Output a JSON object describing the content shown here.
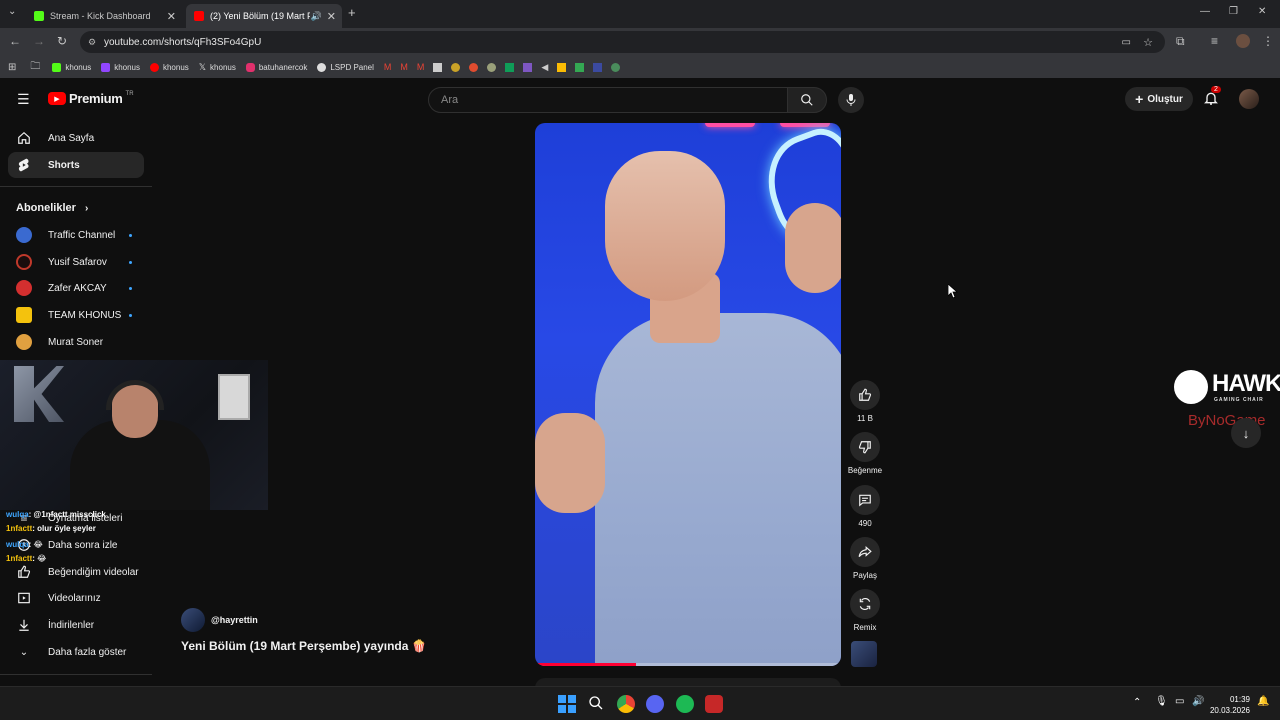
{
  "browser": {
    "tabs": [
      {
        "title": "Stream - Kick Dashboard",
        "favicon_color": "#53fc18"
      },
      {
        "title": "(2) Yeni Bölüm (19 Mart Pe…",
        "favicon_color": "#ff0000"
      }
    ],
    "url": "youtube.com/shorts/qFh3SFo4GpU",
    "bookmarks": [
      {
        "label": "khonus",
        "color": "#53fc18"
      },
      {
        "label": "khonus",
        "color": "#9146ff"
      },
      {
        "label": "khonus",
        "color": "#ff0000"
      },
      {
        "label": "khonus",
        "color": "#ffffff"
      },
      {
        "label": "batuhanercok",
        "color": "#e1306c"
      },
      {
        "label": "LSPD Panel",
        "color": "#ffffff"
      }
    ]
  },
  "youtube": {
    "logo_text": "Premium",
    "logo_suffix": "TR",
    "search_placeholder": "Ara",
    "create_label": "Oluştur",
    "notification_count": "2",
    "sidebar": {
      "main": [
        {
          "label": "Ana Sayfa",
          "icon": "home-icon"
        },
        {
          "label": "Shorts",
          "icon": "shorts-icon"
        }
      ],
      "subscriptions_title": "Abonelikler",
      "subscriptions": [
        {
          "label": "Traffic Channel",
          "color": "#3a6ad0"
        },
        {
          "label": "Yusif Safarov",
          "color": "#c0392b"
        },
        {
          "label": "Zafer AKCAY",
          "color": "#d32f2f"
        },
        {
          "label": "TEAM KHONUS",
          "color": "#f4c20d"
        },
        {
          "label": "Murat Soner",
          "color": "#e0a040"
        }
      ],
      "library": [
        {
          "label": "Oynatma listeleri",
          "icon": "playlist-icon"
        },
        {
          "label": "Daha sonra izle",
          "icon": "clock-icon"
        },
        {
          "label": "Beğendiğim videolar",
          "icon": "thumbs-up-icon"
        },
        {
          "label": "Videolarınız",
          "icon": "video-icon"
        },
        {
          "label": "İndirilenler",
          "icon": "download-icon"
        },
        {
          "label": "Daha fazla göster",
          "icon": "chevron-down-icon"
        }
      ]
    },
    "short": {
      "channel": "@hayrettin",
      "title": "Yeni Bölüm (19 Mart Perşembe) yayında 🍿",
      "progress": 0.33
    },
    "actions": {
      "likes": "11 B",
      "dislike_label": "Beğenme",
      "comments": "490",
      "share_label": "Paylaş",
      "remix_label": "Remix"
    }
  },
  "overlay": {
    "sponsor_name": "HAWK",
    "sponsor_sub": "GAMING CHAIR",
    "sponsor_brand": "ByNoGame",
    "chat": [
      {
        "user": "wulqa",
        "text": ": @1nfactt missclick",
        "color": "#3ea6ff"
      },
      {
        "user": "1nfactt",
        "text": ": olur öyle şeyler",
        "color": "#f4c20d"
      },
      {
        "user": "wulqa",
        "text": ": 😂",
        "color": "#3ea6ff"
      },
      {
        "user": "1nfactt",
        "text": ": 😂",
        "color": "#f4c20d"
      }
    ]
  },
  "taskbar": {
    "time": "01:39",
    "date": "20.03.2026"
  }
}
